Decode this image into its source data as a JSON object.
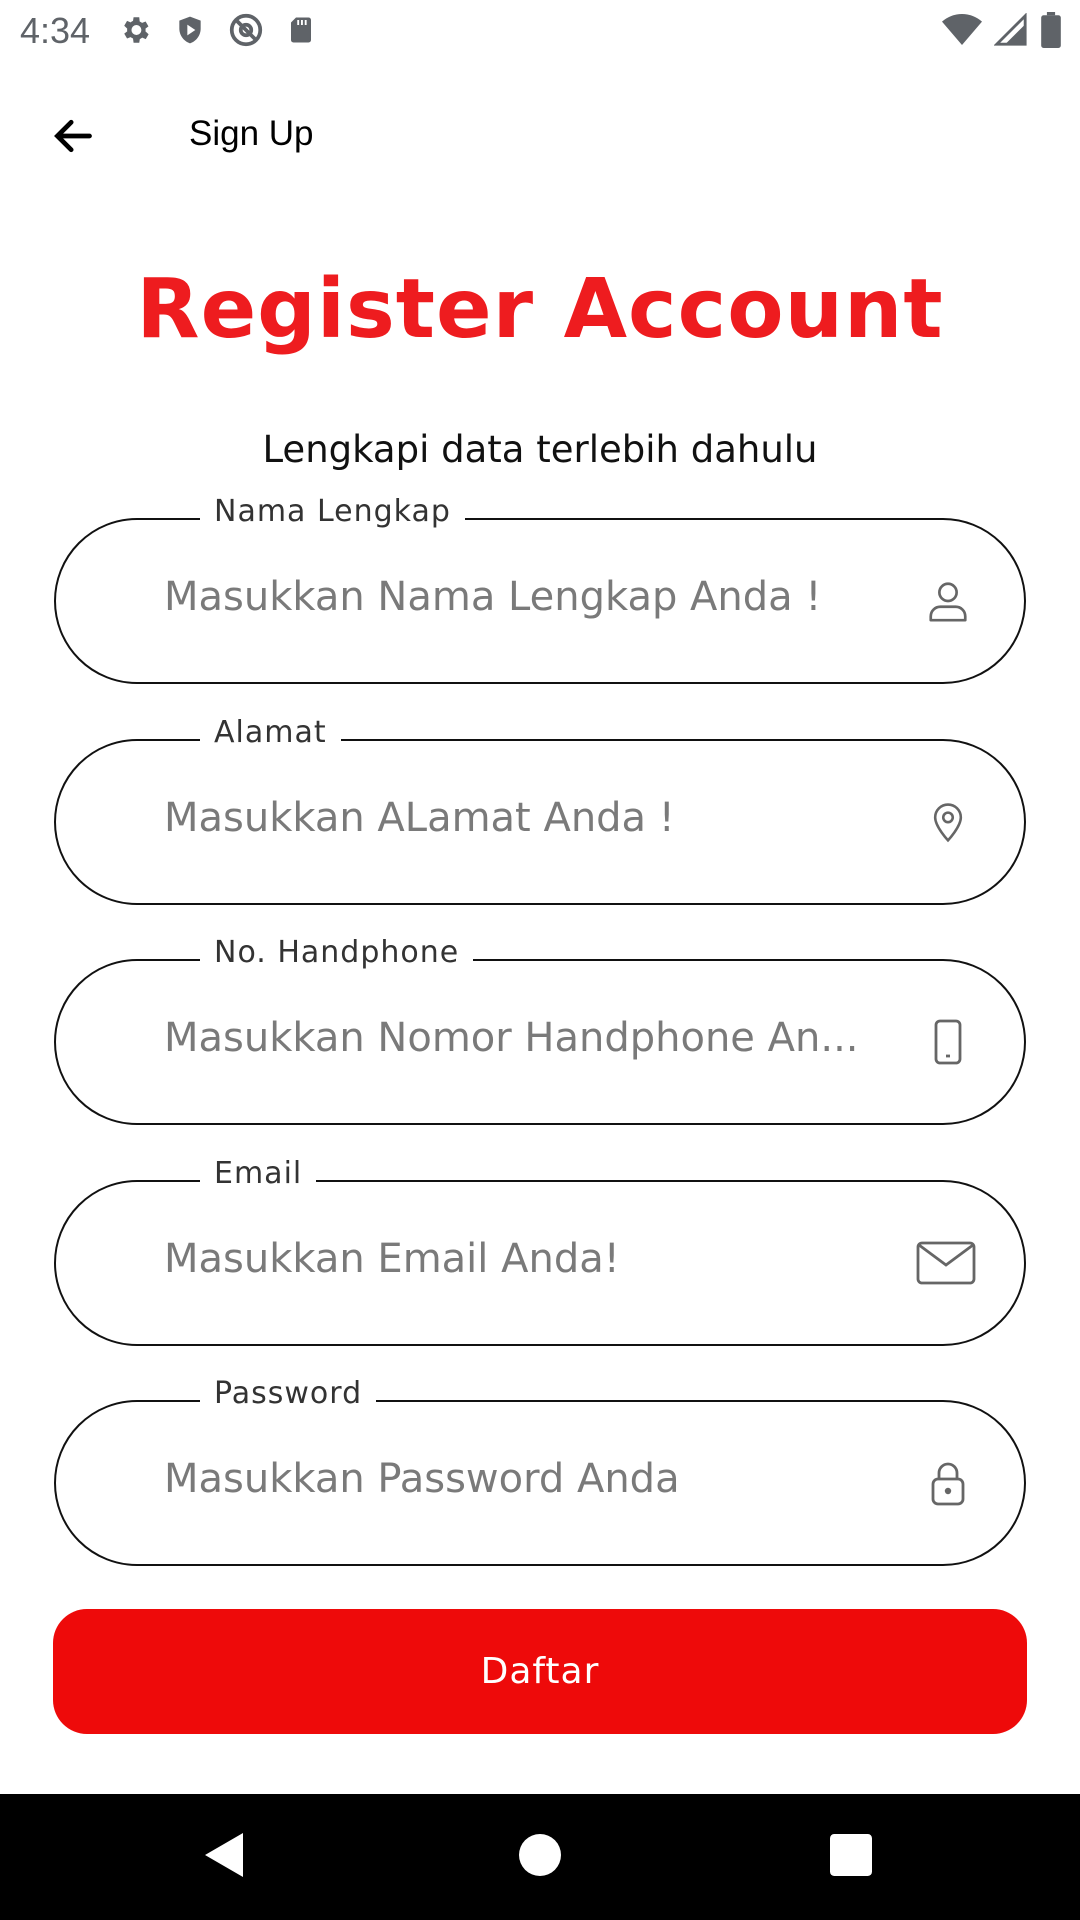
{
  "status_bar": {
    "time": "4:34",
    "left_icons": [
      "settings-icon",
      "shield-icon",
      "at-sign-icon",
      "sd-card-icon"
    ],
    "right_icons": [
      "wifi-icon",
      "signal-icon",
      "battery-icon"
    ]
  },
  "app_bar": {
    "back_icon": "arrow-back-icon",
    "title": "Sign Up"
  },
  "header": {
    "headline": "Register Account",
    "subtitle": "Lengkapi data terlebih dahulu"
  },
  "form": {
    "fields": [
      {
        "label": "Nama Lengkap",
        "placeholder": "Masukkan Nama Lengkap Anda !",
        "value": "",
        "icon": "person-icon"
      },
      {
        "label": "Alamat",
        "placeholder": "Masukkan ALamat Anda !",
        "value": "",
        "icon": "location-pin-icon"
      },
      {
        "label": "No. Handphone",
        "placeholder": "Masukkan Nomor Handphone An...",
        "value": "",
        "icon": "phone-icon"
      },
      {
        "label": "Email",
        "placeholder": "Masukkan Email Anda!",
        "value": "",
        "icon": "mail-icon"
      },
      {
        "label": "Password",
        "placeholder": "Masukkan Password Anda",
        "value": "",
        "icon": "lock-icon"
      }
    ],
    "submit_label": "Daftar"
  },
  "nav_bar": {
    "icons": [
      "nav-back-icon",
      "nav-home-icon",
      "nav-recents-icon"
    ]
  },
  "colors": {
    "accent": "#ee1c1f",
    "button": "#ee0a0a",
    "nav_bar": "#000000"
  }
}
